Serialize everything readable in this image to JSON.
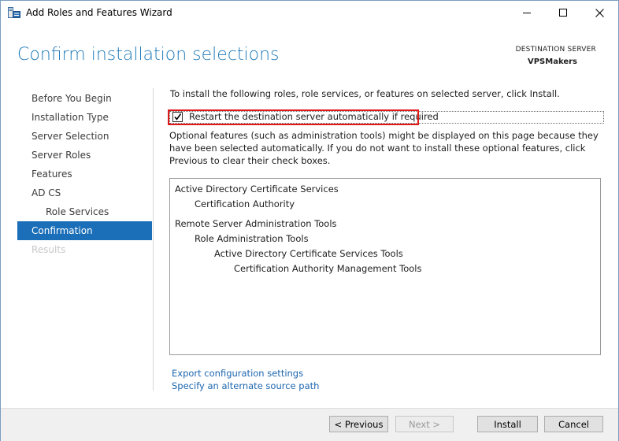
{
  "window": {
    "title": "Add Roles and Features Wizard"
  },
  "header": {
    "page_title": "Confirm installation selections",
    "destination_label": "DESTINATION SERVER",
    "destination_server": "VPSMakers"
  },
  "nav": {
    "items": [
      {
        "label": "Before You Begin",
        "state": "normal"
      },
      {
        "label": "Installation Type",
        "state": "normal"
      },
      {
        "label": "Server Selection",
        "state": "normal"
      },
      {
        "label": "Server Roles",
        "state": "normal"
      },
      {
        "label": "Features",
        "state": "normal"
      },
      {
        "label": "AD CS",
        "state": "normal"
      },
      {
        "label": "Role Services",
        "state": "sub"
      },
      {
        "label": "Confirmation",
        "state": "active"
      },
      {
        "label": "Results",
        "state": "disabled"
      }
    ]
  },
  "content": {
    "intro": "To install the following roles, role services, or features on selected server, click Install.",
    "restart_label": "Restart the destination server automatically if required",
    "restart_checked": true,
    "optional_text": "Optional features (such as administration tools) might be displayed on this page because they have been selected automatically. If you do not want to install these optional features, click Previous to clear their check boxes.",
    "features": [
      {
        "label": "Active Directory Certificate Services",
        "level": 0
      },
      {
        "label": "Certification Authority",
        "level": 1
      },
      {
        "label": "Remote Server Administration Tools",
        "level": 0
      },
      {
        "label": "Role Administration Tools",
        "level": 1
      },
      {
        "label": "Active Directory Certificate Services Tools",
        "level": 2
      },
      {
        "label": "Certification Authority Management Tools",
        "level": 3
      }
    ],
    "export_link": "Export configuration settings",
    "alt_source_link": "Specify an alternate source path"
  },
  "buttons": {
    "previous": "< Previous",
    "next": "Next >",
    "install": "Install",
    "cancel": "Cancel"
  },
  "colors": {
    "accent": "#1b6fb8",
    "title": "#1f7ab8",
    "link": "#1c66b0",
    "highlight": "#e01818"
  }
}
